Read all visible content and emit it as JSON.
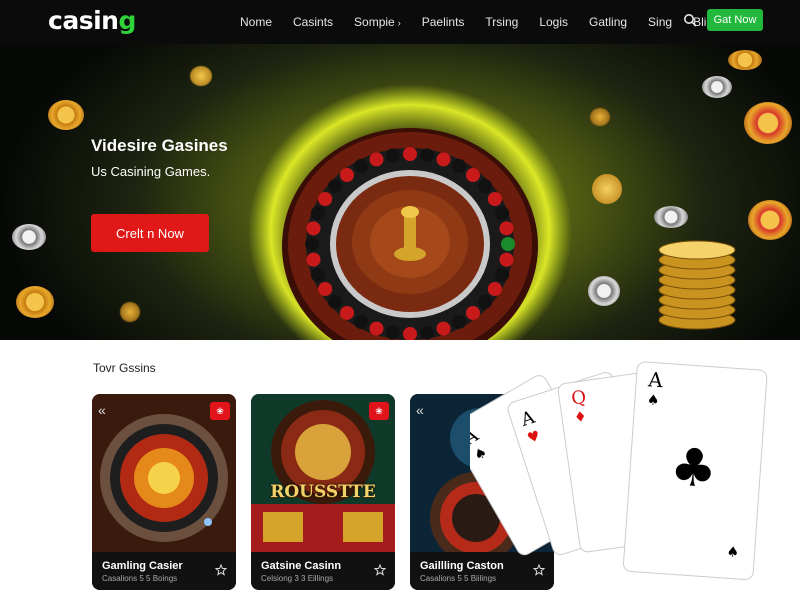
{
  "nav": {
    "logo_text": "casin",
    "logo_accent": "g",
    "items": [
      {
        "label": "Nome",
        "has_caret": false
      },
      {
        "label": "Casints",
        "has_caret": false
      },
      {
        "label": "Sompie",
        "has_caret": true
      },
      {
        "label": "Paelints",
        "has_caret": false
      },
      {
        "label": "Trsing",
        "has_caret": false
      },
      {
        "label": "Logis",
        "has_caret": false
      },
      {
        "label": "Gatling",
        "has_caret": false
      },
      {
        "label": "Sing",
        "has_caret": false
      },
      {
        "label": "Blies",
        "has_caret": false
      }
    ],
    "search_icon": "search-icon",
    "cta_label": "Gat Now"
  },
  "hero": {
    "title": "Videsire Gasines",
    "subtitle": "Us Casining Games.",
    "button_label": "Crelt n Now"
  },
  "games": {
    "section_title": "Tovr Gssins",
    "cards": [
      {
        "title": "Gamling Casier",
        "meta": "Casalions 5 5 Boings",
        "badge": "❀"
      },
      {
        "title": "Gatsine Casinn",
        "meta": "Celsiong 3 3 Eillings",
        "badge": "❀",
        "art_text": "ROUSSTTE"
      },
      {
        "title": "Gaillling Caston",
        "meta": "Casalions 5 5 Biilings"
      }
    ]
  },
  "playing_cards": {
    "ranks": [
      "A",
      "A",
      "Q",
      "A"
    ]
  },
  "colors": {
    "nav_bg": "#0b0b0b",
    "brand_green": "#2fd33a",
    "cta_green": "#22b83b",
    "hero_red": "#e11818",
    "hero_glow": "#8b9a1a"
  }
}
